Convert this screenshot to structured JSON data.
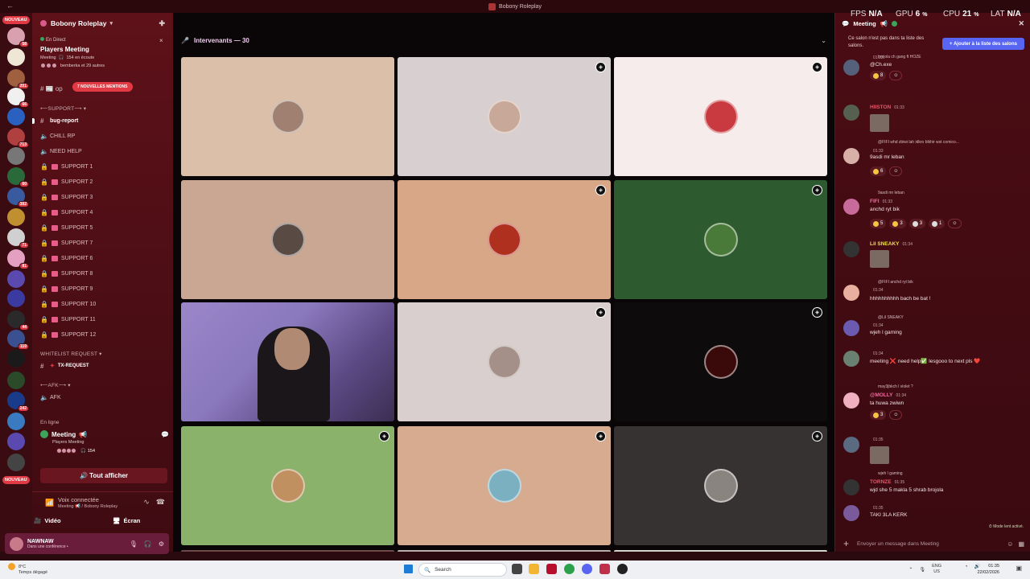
{
  "window": {
    "title": "Bobony Roleplay"
  },
  "hud": {
    "fps_label": "FPS",
    "fps_value": "N/A",
    "gpu_label": "GPU",
    "gpu_value": "6",
    "gpu_unit": "%",
    "cpu_label": "CPU",
    "cpu_value": "21",
    "cpu_unit": "%",
    "lat_label": "LAT",
    "lat_value": "N/A"
  },
  "rail": {
    "badge_top": "NOUVEAU",
    "badge_bottom": "NOUVEAU",
    "servers": [
      {
        "count": "58",
        "color": "#d9a0b0"
      },
      {
        "count": "",
        "color": "#f0e6d6"
      },
      {
        "count": "201",
        "color": "#a06040"
      },
      {
        "count": "66",
        "color": "#f0f0f0"
      },
      {
        "count": "",
        "color": "#2a60c0"
      },
      {
        "count": "713",
        "color": "#b04040"
      },
      {
        "count": "",
        "color": "#777"
      },
      {
        "count": "60",
        "color": "#2a6a3a"
      },
      {
        "count": "392",
        "color": "#3a5aa0"
      },
      {
        "count": "",
        "color": "#c09030"
      },
      {
        "count": "71",
        "color": "#d0d0d0"
      },
      {
        "count": "81",
        "color": "#e4a0c0"
      },
      {
        "count": "",
        "color": "#5a4ab0"
      },
      {
        "count": "",
        "color": "#3a3aa0"
      },
      {
        "count": "44",
        "color": "#2a2a2a"
      },
      {
        "count": "119",
        "color": "#3a5090"
      },
      {
        "count": "",
        "color": "#1a1a1a"
      },
      {
        "count": "",
        "color": "#2a4a2a"
      },
      {
        "count": "242",
        "color": "#1a3a8a"
      },
      {
        "count": "",
        "color": "#3a7ac0"
      },
      {
        "count": "",
        "color": "#5a4ab0"
      },
      {
        "count": "",
        "color": "#444"
      }
    ]
  },
  "sidebar": {
    "guild_name": "Bobony Roleplay",
    "event": {
      "live": "En Direct",
      "title": "Players Meeting",
      "channel": "Meeting",
      "listening": "154 en écoute",
      "hosts": "bemberka et 29 autres"
    },
    "mentions": "7 NOUVELLES MENTIONS",
    "cat_support": "SUPPORT",
    "cat_whitelist": "WHITELIST REQUEST",
    "cat_afk": "AFK",
    "channels": [
      {
        "name": "bug-report",
        "type": "text",
        "bold": true
      },
      {
        "name": "CHILL RP",
        "type": "voice",
        "bold": false
      },
      {
        "name": "NEED HELP",
        "type": "voice",
        "bold": false
      },
      {
        "name": "SUPPORT 1",
        "type": "lock",
        "bold": false
      },
      {
        "name": "SUPPORT 2",
        "type": "lock",
        "bold": false
      },
      {
        "name": "SUPPORT 3",
        "type": "lock",
        "bold": false
      },
      {
        "name": "SUPPORT 4",
        "type": "lock",
        "bold": false
      },
      {
        "name": "SUPPORT 5",
        "type": "lock",
        "bold": false
      },
      {
        "name": "SUPPORT 7",
        "type": "lock",
        "bold": false
      },
      {
        "name": "SUPPORT 6",
        "type": "lock",
        "bold": false
      },
      {
        "name": "SUPPORT 8",
        "type": "lock",
        "bold": false
      },
      {
        "name": "SUPPORT 9",
        "type": "lock",
        "bold": false
      },
      {
        "name": "SUPPORT 10",
        "type": "lock",
        "bold": false
      },
      {
        "name": "SUPPORT 11",
        "type": "lock",
        "bold": false
      },
      {
        "name": "SUPPORT 12",
        "type": "lock",
        "bold": false
      }
    ],
    "tx_request": "TX-REQUEST",
    "afk_channel": "AFK",
    "online": "En ligne",
    "voice_channel": {
      "name": "Meeting",
      "sub": "Players Meeting",
      "count": "154"
    },
    "show_all": "Tout afficher",
    "voice_connected": {
      "title": "Voix connectée",
      "sub": "Meeting 📢 / Bobony Roleplay"
    },
    "video_label": "Vidéo",
    "screen_label": "Écran",
    "user": {
      "name": "NAWNAW",
      "status": "Dans une conférence •"
    }
  },
  "stage": {
    "speakers": "Intervenants — 30",
    "tiles": [
      {
        "bg": "#dcbfa8",
        "av": "#a08070",
        "pin": false
      },
      {
        "bg": "#d8cfd1",
        "av": "#c8a898",
        "pin": true
      },
      {
        "bg": "#f6eceb",
        "av": "#c83a40",
        "pin": true
      },
      {
        "bg": "#c9a793",
        "av": "#5a4a44",
        "pin": false
      },
      {
        "bg": "#d7a788",
        "av": "#b03020",
        "pin": true
      },
      {
        "bg": "#2e5a2f",
        "av": "#4a7a3a",
        "pin": true
      },
      {
        "bg": "cam",
        "av": "",
        "pin": false
      },
      {
        "bg": "#d9cfcf",
        "av": "#a49088",
        "pin": true
      },
      {
        "bg": "#0d0b0b",
        "av": "#3a0a0a",
        "pin": true
      },
      {
        "bg": "#8bb26a",
        "av": "#c09060",
        "pin": true
      },
      {
        "bg": "#d6ab90",
        "av": "#7ab0c0",
        "pin": true
      },
      {
        "bg": "#363232",
        "av": "#8a8480",
        "pin": true
      }
    ]
  },
  "chat": {
    "channel": "Meeting",
    "notice": "Ce salon n'est pas dans ta liste des salons.",
    "add_button": "+ Ajouter à la liste des salons",
    "messages": [
      {
        "reply": "brojola ch gang ft HOZE",
        "author": "",
        "time": "01:32",
        "text": "@Ch.exe",
        "color": "#e05a6a"
      },
      {
        "reply": "",
        "author": "HIISTON",
        "time": "01:33",
        "text": "",
        "color": "#e05a6a"
      },
      {
        "reply": "@FIFI whd zbiwi lah idkro blkhir wst comico...",
        "author": "",
        "time": "01:33",
        "text": "9asdi mr leban",
        "color": "#e05a6a"
      },
      {
        "reply": "9asdi mr leban",
        "author": "FIFI",
        "time": "01:33",
        "text": "anchd ryt bik",
        "color": "#f06aa0"
      },
      {
        "reply": "",
        "author": "Lil SNEAKY",
        "time": "01:34",
        "text": "",
        "color": "#f0e040"
      },
      {
        "reply": "@FIFI anchd ryt bik",
        "author": "",
        "time": "01:34",
        "text": "hhhhhhhhhh bach be bat !",
        "color": "#e05a6a"
      },
      {
        "reply": "@Lil SNEAKY",
        "author": "",
        "time": "01:34",
        "text": "wjeh l gaming",
        "color": "#c03a4a"
      },
      {
        "reply": "",
        "author": "",
        "time": "01:34",
        "text": "meeting ❌ need help✅ lesgooo to next pls ❤️",
        "color": "#c03a4a"
      },
      {
        "reply": "may3jbkch l violet ?",
        "author": "@MOLLY",
        "time": "01:34",
        "text": "ta huwa zwiwn",
        "color": "#f06aa0"
      },
      {
        "reply": "",
        "author": "",
        "time": "01:35",
        "text": "",
        "color": "#c03a4a"
      },
      {
        "reply": "wjeh l gaming",
        "author": "TORNZE",
        "time": "01:35",
        "text": "wjd she 5 makla 5 shrab brojola",
        "color": "#e05a6a"
      },
      {
        "reply": "",
        "author": "",
        "time": "01:35",
        "text": "TAKI 3LA KERK",
        "color": "#c03a4a"
      }
    ],
    "reactions": {
      "m1": "8",
      "m3": "6",
      "m4a": "5",
      "m4b": "3",
      "m4c": "3",
      "m4d": "1",
      "m9": "3"
    },
    "slow_mode": "Mode lent activé.",
    "placeholder": "Envoyer un message dans Meeting"
  },
  "taskbar": {
    "temp": "8°C",
    "weather": "Temps dégagé",
    "search": "Search",
    "lang": "ENG",
    "region": "US",
    "time": "01:35",
    "date": "22/02/2026"
  }
}
